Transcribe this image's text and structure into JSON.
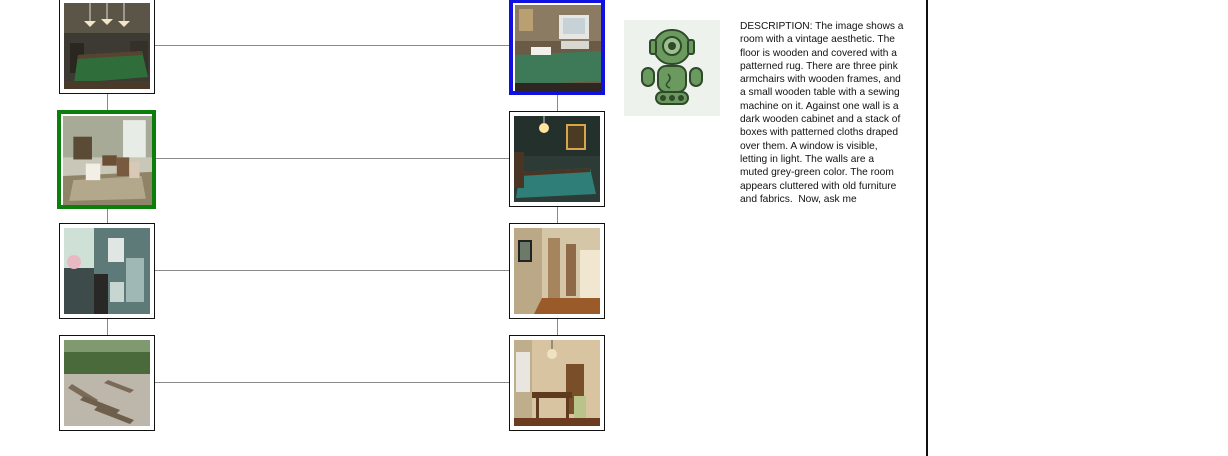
{
  "grid": {
    "left_column": [
      {
        "alt": "billiard room with green pool table and hanging lamps",
        "selected": false
      },
      {
        "alt": "vintage room with armchairs and wooden table",
        "selected": true,
        "selection_color": "#0a7f0a"
      },
      {
        "alt": "kitchen with window and hanging towels",
        "selected": false
      },
      {
        "alt": "outdoor patio with lounge chairs under trees",
        "selected": false
      }
    ],
    "right_column": [
      {
        "alt": "study with old computer on green desk",
        "selected": true,
        "selection_color": "#1010e0"
      },
      {
        "alt": "dark room with pool table and chandelier",
        "selected": false
      },
      {
        "alt": "hallway with wooden floor and doors",
        "selected": false
      },
      {
        "alt": "dining room with chandelier and table",
        "selected": false
      }
    ]
  },
  "assistant": {
    "avatar_icon": "robot-icon",
    "description": "DESCRIPTION: The image shows a room with a vintage aesthetic. The floor is wooden and covered with a patterned rug. There are three pink armchairs with wooden frames, and a small wooden table with a sewing machine on it. Against one wall is a dark wooden cabinet and a stack of boxes with patterned cloths draped over them. A window is visible, letting in light. The walls are a muted grey-green color. The room appears cluttered with old furniture and fabrics.  Now, ask me"
  },
  "colors": {
    "selected_left": "#0a7f0a",
    "selected_right": "#1010e0",
    "connector": "#8a8a8a",
    "robot_green": "#6b9a5e"
  }
}
